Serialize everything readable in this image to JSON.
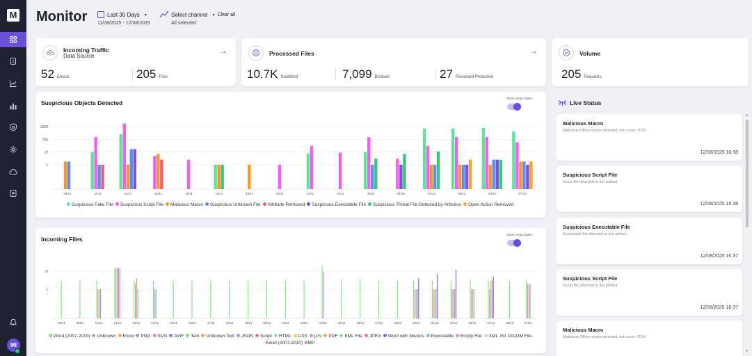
{
  "header": {
    "title": "Monitor",
    "date_range_label": "Last 30 Days",
    "date_range_value": "11/08/2025 - 12/08/2025",
    "channel_label": "Select channel",
    "channel_value": "All selected",
    "clear_all": "Clear all"
  },
  "sidebar": {
    "logo": "M",
    "items": [
      {
        "icon": "dashboard-icon",
        "active": true
      },
      {
        "icon": "document-icon",
        "active": false
      },
      {
        "icon": "chart-icon",
        "active": false
      },
      {
        "icon": "stats-icon",
        "active": false
      },
      {
        "icon": "shield-icon",
        "active": false
      },
      {
        "icon": "gear-icon",
        "active": false
      },
      {
        "icon": "cloud-icon",
        "active": false
      },
      {
        "icon": "report-icon",
        "active": false
      }
    ],
    "bell_icon": "bell-icon",
    "avatar": "MI"
  },
  "cards": {
    "incoming_traffic": {
      "title": "Incoming Traffic",
      "subtitle": "Data Source",
      "stats": [
        {
          "value": "52",
          "label": "Emails"
        },
        {
          "value": "205",
          "label": "Files"
        }
      ]
    },
    "processed_files": {
      "title": "Processed Files",
      "stats": [
        {
          "value": "10.7K",
          "label": "Sanitized"
        },
        {
          "value": "7,099",
          "label": "Blocked"
        },
        {
          "value": "27",
          "label": "Password Protected"
        }
      ]
    },
    "volume": {
      "title": "Volume",
      "stats": [
        {
          "value": "205",
          "label": "Requests"
        }
      ]
    }
  },
  "suspicious_panel": {
    "title": "Suspicious Objects Detected",
    "toggle_label": "Show empty dates"
  },
  "incoming_panel": {
    "title": "Incoming Files",
    "toggle_label": "Show empty dates"
  },
  "chart_data": [
    {
      "type": "bar",
      "title": "Suspicious Objects Detected",
      "y_scale": "log",
      "y_ticks": [
        "1000",
        "100",
        "10",
        "1"
      ],
      "x": [
        "09/11",
        "10/11",
        "11/11",
        "12/11",
        "13/11",
        "16/11",
        "18/11",
        "19/11",
        "23/11",
        "24/11",
        "30/11",
        "01/12",
        "02/12",
        "03/12",
        "04/12",
        "07/12"
      ],
      "series": [
        {
          "name": "Suspicious Fake File",
          "color": "#5ee39a",
          "values": [
            0,
            10,
            250,
            0,
            0,
            1,
            0,
            0,
            8,
            0,
            10,
            0,
            700,
            700,
            800,
            400
          ]
        },
        {
          "name": "Suspicious Script File",
          "color": "#f25ef2",
          "values": [
            0,
            150,
            1700,
            5,
            2.5,
            0,
            0,
            1,
            30,
            9,
            150,
            3,
            30,
            150,
            150,
            60
          ]
        },
        {
          "name": "Malicious Macro",
          "color": "#f5962a",
          "values": [
            1.8,
            0,
            1,
            7,
            0,
            1,
            1,
            0,
            0,
            0,
            0,
            0,
            1,
            1,
            1,
            1.8
          ]
        },
        {
          "name": "Suspicious Unknown File",
          "color": "#5b8ef0",
          "values": [
            1.8,
            1,
            17,
            0,
            0,
            0,
            0,
            0,
            0,
            0,
            1,
            0,
            1,
            1,
            2.5,
            1.8
          ]
        },
        {
          "name": "Attribute Removed",
          "color": "#f25e6e",
          "values": [
            0,
            1,
            0,
            2.5,
            0,
            0,
            0,
            0,
            0,
            0,
            0,
            0,
            0,
            0,
            0,
            0
          ]
        },
        {
          "name": "Suspicious Executable File",
          "color": "#7b52d9",
          "values": [
            0,
            0,
            17,
            0,
            0,
            0,
            0,
            0,
            0,
            0,
            0,
            1,
            0,
            1,
            2.5,
            1
          ]
        },
        {
          "name": "Suspicious Threat File Detected by Antivirus",
          "color": "#3cc47a",
          "values": [
            0,
            0,
            0,
            0,
            0,
            1,
            0,
            0,
            0,
            0,
            3,
            7,
            11,
            0,
            2.5,
            0
          ]
        },
        {
          "name": "Open Action Removed",
          "color": "#f5a52a",
          "values": [
            0,
            0,
            0,
            0,
            0,
            0,
            0,
            0,
            0,
            0,
            0,
            0,
            0,
            2.5,
            0,
            1.8
          ]
        }
      ]
    },
    {
      "type": "bar",
      "title": "Incoming Files",
      "y_scale": "log",
      "y_ticks": [
        "10",
        "1"
      ],
      "x": [
        "08/11",
        "09/11",
        "10/11",
        "11/11",
        "12/11",
        "13/11",
        "15/11",
        "16/11",
        "17/11",
        "18/11",
        "19/11",
        "20/11",
        "21/11",
        "22/11",
        "23/11",
        "24/11",
        "26/11",
        "27/11",
        "29/11",
        "30/11",
        "01/12",
        "02/12",
        "03/12",
        "04/12",
        "06/12",
        "07/12"
      ],
      "series": [
        {
          "name": "Word (2007-2010)",
          "color": "#7ee87e",
          "values": [
            3,
            3,
            3,
            15,
            3,
            3,
            3,
            3,
            3,
            3,
            3,
            3,
            3,
            3,
            20,
            3,
            3,
            3,
            3,
            3,
            3,
            3,
            3,
            3,
            3,
            3
          ]
        },
        {
          "name": "Unknown",
          "color": "#c79ac7",
          "values": [
            0,
            0,
            1,
            15,
            2,
            1,
            0,
            0,
            0,
            0,
            0,
            0,
            0,
            0,
            0,
            0,
            0,
            0,
            0,
            1,
            1,
            1,
            1,
            1,
            0,
            2
          ]
        },
        {
          "name": "Excel",
          "color": "#f5a54a",
          "values": [
            0,
            0,
            1,
            15,
            4,
            0,
            0,
            0,
            0,
            0,
            0,
            0,
            0,
            0,
            0,
            0,
            0,
            0,
            0,
            1,
            1,
            1,
            1,
            3,
            0,
            2
          ]
        },
        {
          "name": "PNG",
          "color": "#7da7e8",
          "values": [
            0,
            0,
            1,
            15,
            1,
            1,
            0,
            0,
            0,
            0,
            0,
            0,
            0,
            0,
            0,
            0,
            0,
            0,
            0,
            1,
            1,
            1,
            1,
            3,
            0,
            2
          ]
        },
        {
          "name": "SVG",
          "color": "#f27bd0",
          "values": [
            0,
            0,
            0,
            15,
            0,
            0,
            0,
            0,
            0,
            0,
            0,
            0,
            0,
            0,
            9,
            0,
            0,
            0,
            0,
            0,
            0,
            0,
            0,
            0,
            0,
            0
          ]
        },
        {
          "name": "Word with Macros",
          "color": "#8c5ae0",
          "values": [
            0,
            0,
            0,
            0,
            0,
            0,
            0,
            0,
            0,
            0,
            0,
            0,
            0,
            0,
            0,
            0,
            0,
            0,
            0,
            4,
            7,
            12,
            0,
            5,
            0,
            0
          ]
        }
      ]
    }
  ],
  "legend_suspicious": [
    {
      "name": "Suspicious Fake File",
      "color": "#5ee39a"
    },
    {
      "name": "Suspicious Script File",
      "color": "#f25ef2"
    },
    {
      "name": "Malicious Macro",
      "color": "#f5962a"
    },
    {
      "name": "Suspicious Unknown File",
      "color": "#5b8ef0"
    },
    {
      "name": "Attribute Removed",
      "color": "#f25e6e"
    },
    {
      "name": "Suspicious Executable File",
      "color": "#7b52d9"
    },
    {
      "name": "Suspicious Threat File Detected by Antivirus",
      "color": "#3cc47a"
    },
    {
      "name": "Open Action Removed",
      "color": "#f5a52a"
    }
  ],
  "legend_incoming": [
    {
      "name": "Word (2007-2010)",
      "color": "#7ee87e"
    },
    {
      "name": "Unknown",
      "color": "#c79ac7"
    },
    {
      "name": "Excel",
      "color": "#f5a54a"
    },
    {
      "name": "PNG",
      "color": "#7da7e8"
    },
    {
      "name": "SVG",
      "color": "#f27bd0"
    },
    {
      "name": "AVIF",
      "color": "#b06ad8"
    },
    {
      "name": "Text",
      "color": "#7ee87e"
    },
    {
      "name": "Unknown Text",
      "color": "#f5a54a"
    },
    {
      "name": "JSON",
      "color": "#7da7e8"
    },
    {
      "name": "Script",
      "color": "#f27b7b"
    },
    {
      "name": "HTML",
      "color": "#8ce0c8"
    },
    {
      "name": "CSS",
      "color": "#f5c86a"
    },
    {
      "name": "p7s",
      "color": "#d88ae8"
    },
    {
      "name": "PDF",
      "color": "#f5a54a"
    },
    {
      "name": "EML File",
      "color": "#8ce88c"
    },
    {
      "name": "JPEG",
      "color": "#f27b7b"
    },
    {
      "name": "Word with Macros",
      "color": "#8c5ae0"
    },
    {
      "name": "Executable",
      "color": "#7db7e8"
    },
    {
      "name": "Empty File",
      "color": "#f290b0"
    },
    {
      "name": "XML",
      "color": "#b8f0b8"
    },
    {
      "name": "INI",
      "color": ""
    },
    {
      "name": "DICOM File",
      "color": ""
    },
    {
      "name": "Excel (2007-2010)",
      "color": ""
    },
    {
      "name": "BMP",
      "color": ""
    }
  ],
  "live_status": {
    "title": "Live Status",
    "items": [
      {
        "title": "Malicious Macro",
        "desc": "Malicious Office macro detected, risk score: 81%.",
        "time": "12/08/2025 16:38"
      },
      {
        "title": "Suspicious Script File",
        "desc": "Script file detected in the artifact.",
        "time": "12/08/2025 16:38"
      },
      {
        "title": "Suspicious Executable File",
        "desc": "Executable file detected in the artifact.",
        "time": "12/08/2025 16:37"
      },
      {
        "title": "Suspicious Script File",
        "desc": "Script file detected in the artifact.",
        "time": "12/08/2025 16:37"
      },
      {
        "title": "Malicious Macro",
        "desc": "Malicious Office macro detected, risk score: 81%.",
        "time": ""
      }
    ]
  },
  "colors": {
    "sidebar": "#1f2233",
    "accent": "#6b4fd8",
    "background": "#eef0f5"
  }
}
